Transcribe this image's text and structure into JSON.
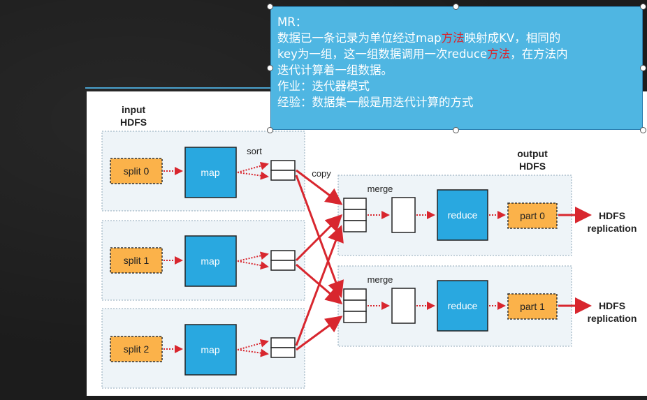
{
  "callout": {
    "title": "MR：",
    "line1_a": "数据已一条记录为单位经过map",
    "line1_red": "方法",
    "line1_b": "映射成KV，相同的",
    "line2_a": "key为一组，这一组数据调用一次reduce",
    "line2_red": "方法",
    "line2_b": "，在方法内",
    "line3": "迭代计算着一组数据。",
    "line4": "作业：迭代器模式",
    "line5": "经验：数据集一般是用迭代计算的方式"
  },
  "diagram": {
    "input_label_1": "input",
    "input_label_2": "HDFS",
    "output_label_1": "output",
    "output_label_2": "HDFS",
    "sort_label": "sort",
    "copy_label": "copy",
    "merge_label": "merge",
    "map_label": "map",
    "reduce_label": "reduce",
    "splits": [
      "split 0",
      "split 1",
      "split 2"
    ],
    "parts": [
      "part 0",
      "part 1"
    ],
    "hdfs_repl_1": "HDFS",
    "hdfs_repl_2": "replication"
  },
  "colors": {
    "map_fill": "#29a8e0",
    "split_fill": "#fbb24a",
    "arrow": "#d8262e",
    "callout_bg": "#4fb6e2"
  }
}
